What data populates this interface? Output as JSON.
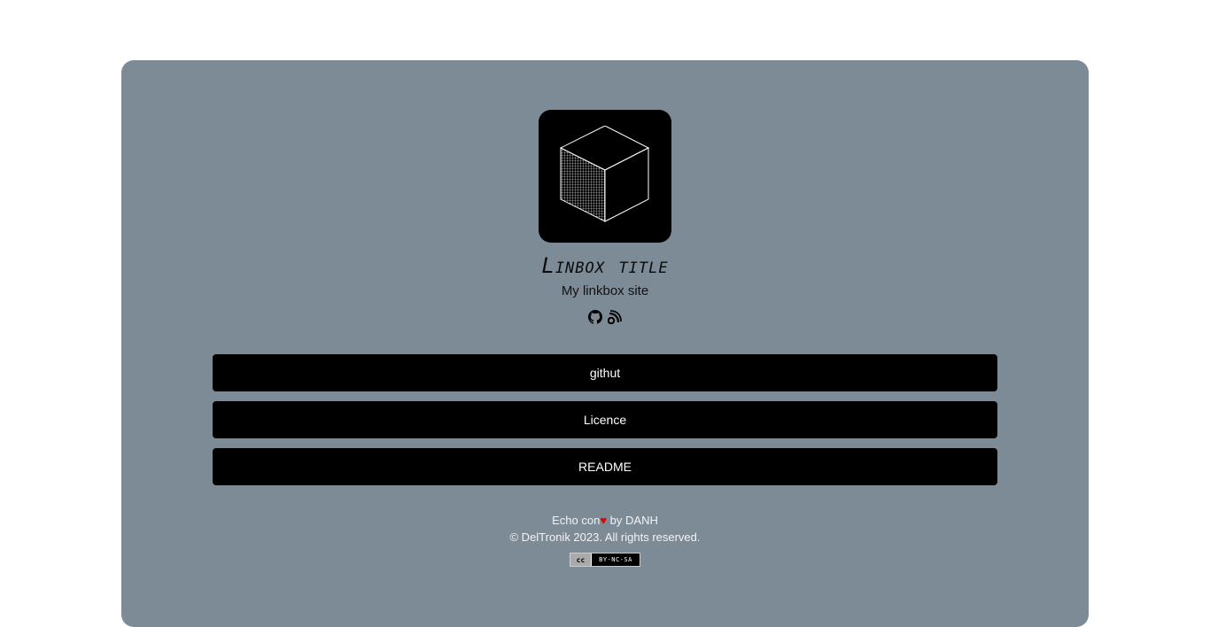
{
  "profile": {
    "title": "Linbox title",
    "subtitle": "My linkbox site"
  },
  "socials": [
    {
      "icon": "github-icon"
    },
    {
      "icon": "blog-feed-icon"
    }
  ],
  "links": [
    {
      "label": "githut"
    },
    {
      "label": "Licence"
    },
    {
      "label": "README"
    }
  ],
  "footer": {
    "made_prefix": "Echo con",
    "heart": "♥",
    "made_suffix": "by DANH",
    "copyright": "© DelTronik 2023. All rights reserved.",
    "badge_logo": "cc",
    "badge_text": "BY-NC-SA"
  },
  "colors": {
    "card_bg": "#7d8b97",
    "button_bg": "#000000",
    "heart": "#e00000"
  }
}
